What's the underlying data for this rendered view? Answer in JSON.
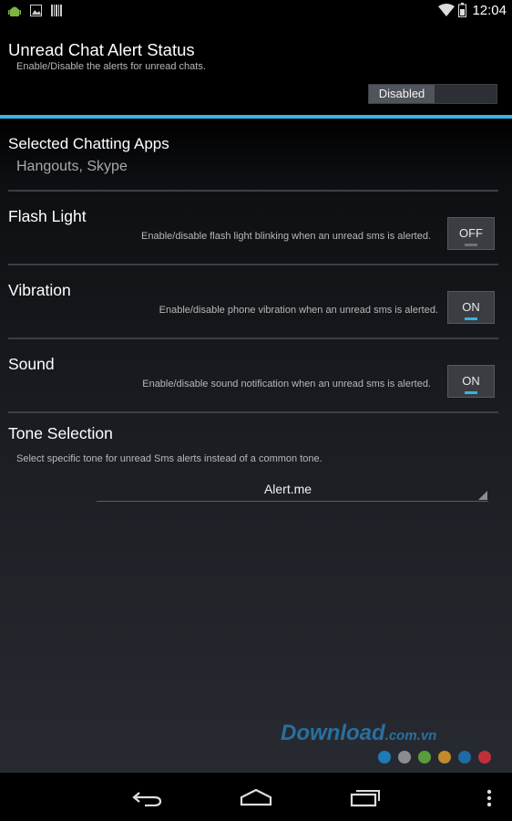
{
  "status_bar": {
    "time": "12:04",
    "left_icons": [
      "android-debug-icon",
      "image-icon",
      "barcode-icon"
    ],
    "right_icons": [
      "wifi-icon",
      "battery-icon"
    ]
  },
  "alert_status": {
    "title": "Unread Chat Alert Status",
    "subtitle": "Enable/Disable the alerts for unread chats.",
    "toggle_label": "Disabled"
  },
  "chatting_apps": {
    "title": "Selected Chatting Apps",
    "value": "Hangouts, Skype"
  },
  "flash_light": {
    "title": "Flash Light",
    "description": "Enable/disable flash light blinking when an unread sms is alerted.",
    "toggle": "OFF"
  },
  "vibration": {
    "title": "Vibration",
    "description": "Enable/disable phone vibration when an unread sms is alerted.",
    "toggle": "ON"
  },
  "sound": {
    "title": "Sound",
    "description": "Enable/disable sound notification when an unread sms is alerted.",
    "toggle": "ON"
  },
  "tone_selection": {
    "title": "Tone Selection",
    "description": "Select specific tone for unread Sms alerts instead of a common tone.",
    "selected": "Alert.me"
  },
  "watermark": {
    "brand": "Download",
    "suffix": ".com.vn",
    "dot_colors": [
      "#1f7ab5",
      "#8a8d90",
      "#5a9c3a",
      "#c4892a",
      "#1f6aa5",
      "#c0303a"
    ]
  },
  "nav_bar": {
    "buttons": [
      "back-icon",
      "home-icon",
      "recents-icon",
      "overflow-menu-icon"
    ]
  },
  "colors": {
    "accent": "#33b5e5",
    "divider": "#3b3f45"
  }
}
